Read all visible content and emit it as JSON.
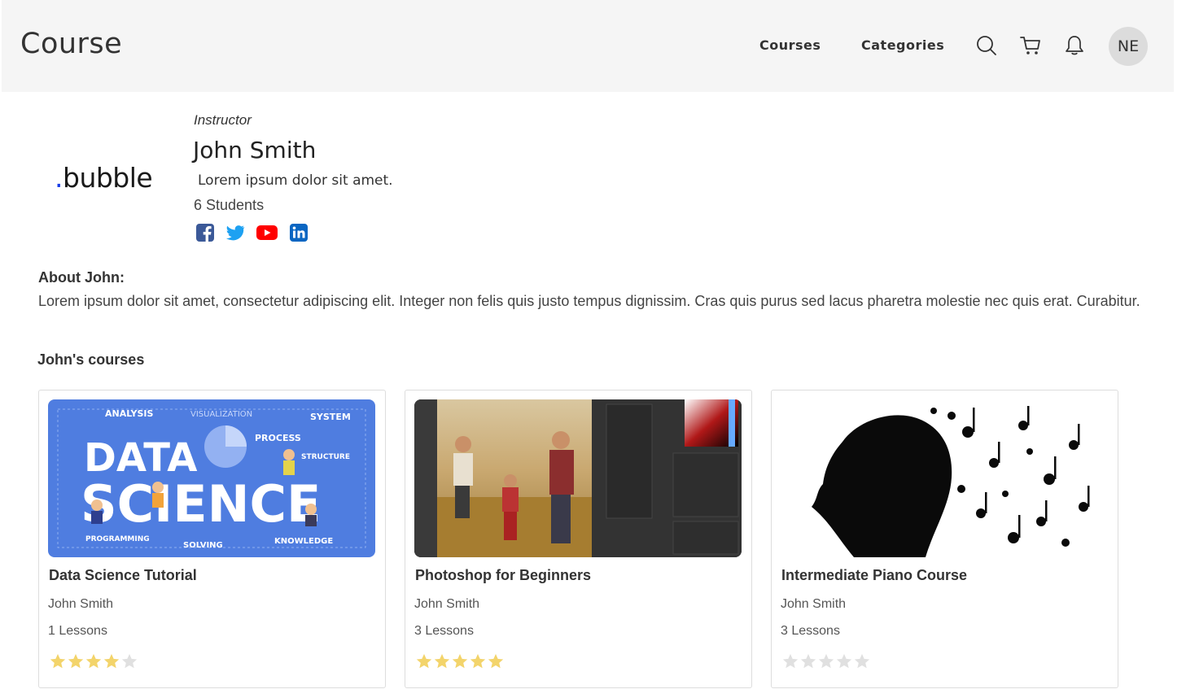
{
  "header": {
    "brand": "Course",
    "nav": {
      "courses": "Courses",
      "categories": "Categories"
    },
    "icons": [
      "search-icon",
      "cart-icon",
      "bell-icon"
    ],
    "avatar_initials": "NE"
  },
  "instructor": {
    "logo_text": "bubble",
    "logo_dot": ".",
    "role": "Instructor",
    "name": "John Smith",
    "tagline": "Lorem ipsum dolor sit amet.",
    "students": "6 Students",
    "social": [
      "facebook-icon",
      "twitter-icon",
      "youtube-icon",
      "linkedin-icon"
    ]
  },
  "about": {
    "title": "About John:",
    "text": "Lorem ipsum dolor sit amet, consectetur adipiscing elit. Integer non felis quis justo tempus dignissim. Cras quis purus sed lacus pharetra molestie nec quis erat. Curabitur."
  },
  "courses": {
    "title": "John's courses",
    "items": [
      {
        "title": "Data Science Tutorial",
        "author": "John Smith",
        "lessons": "1 Lessons",
        "rating": 4,
        "image": "data-science-illustration"
      },
      {
        "title": "Photoshop for Beginners",
        "author": "John Smith",
        "lessons": "3 Lessons",
        "rating": 5,
        "image": "photoshop-family-photo"
      },
      {
        "title": "Intermediate Piano Course",
        "author": "John Smith",
        "lessons": "3 Lessons",
        "rating": 0,
        "image": "music-notes-silhouette"
      }
    ]
  },
  "colors": {
    "header_bg": "#f5f5f5",
    "star_filled": "#f3d46b",
    "star_empty": "#e0e0e0",
    "data_science_bg": "#4f7de0",
    "logo_dot": "#1a3ee8"
  }
}
